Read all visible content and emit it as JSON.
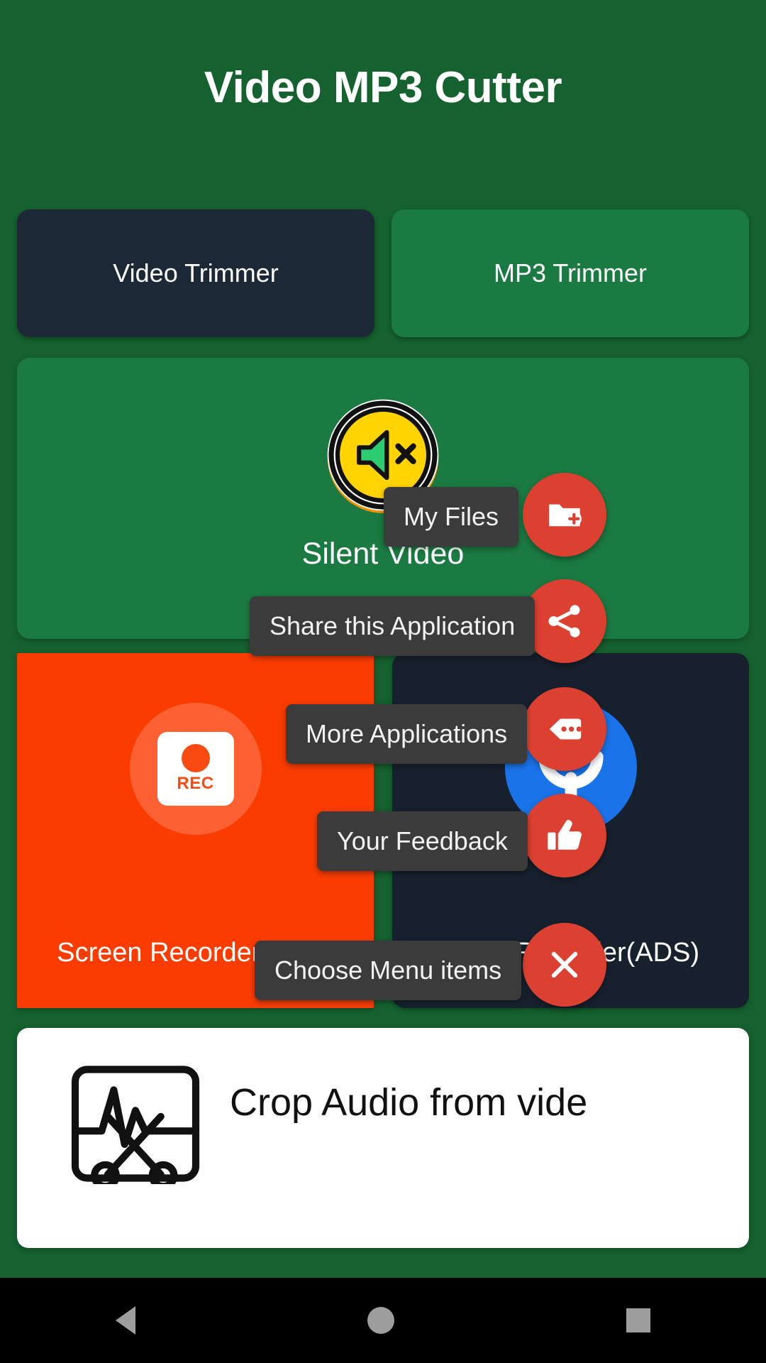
{
  "app": {
    "title": "Video MP3 Cutter",
    "background_color": "#15612f"
  },
  "tabs": [
    {
      "label": "Video Trimmer",
      "state": "selected",
      "bg": "#1d2836"
    },
    {
      "label": "MP3 Trimmer",
      "state": "unselected",
      "bg": "#1b7a42"
    }
  ],
  "silent_panel": {
    "label": "Silent Video",
    "icon": "mute-speaker-icon",
    "bg": "#1b7a42"
  },
  "tiles": [
    {
      "label": "Screen Recorder(ADS)",
      "icon": "rec-badge-icon",
      "icon_text": "REC",
      "bg": "#fa3c00"
    },
    {
      "label": "Voice Recorder(ADS)",
      "icon": "microphone-icon",
      "bg": "#17212e"
    }
  ],
  "bottom_card": {
    "label": "Crop Audio from vide",
    "icon": "scissors-waveform-icon",
    "bg": "#ffffff"
  },
  "fab_menu": {
    "accent_color": "#dc4030",
    "items": [
      {
        "tooltip": "My Files",
        "icon": "folder-plus-icon"
      },
      {
        "tooltip": "Share this Application",
        "icon": "share-icon"
      },
      {
        "tooltip": "More Applications",
        "icon": "tag-dots-icon"
      },
      {
        "tooltip": "Your Feedback",
        "icon": "thumbs-up-icon"
      },
      {
        "tooltip": "Choose Menu items",
        "icon": "close-icon"
      }
    ]
  },
  "navbar": {
    "back": "back-triangle-icon",
    "home": "home-circle-icon",
    "recents": "recents-square-icon"
  }
}
